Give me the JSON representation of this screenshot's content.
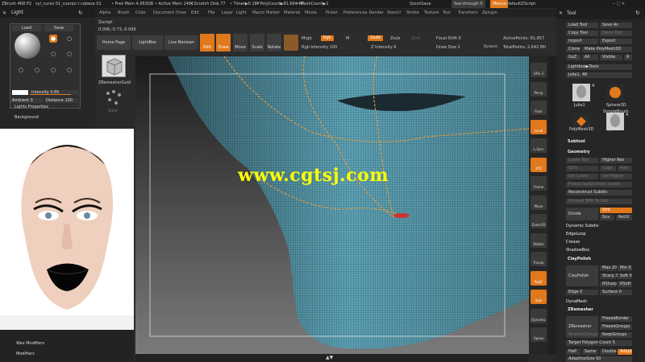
{
  "titlebar": {
    "app": "ZBrush 4R8 P2",
    "file": "syl_curso 01_cuerpo t cabeza 01",
    "free_mem": "• Free Mem 4.063GB",
    "active_mem": "• Active Mem 1461",
    "scratch": "• Scratch Disk 77",
    "timer": "• Timer▶0.187",
    "polycount": "• PolyCount▶81.664 KP",
    "meshcount": "• MeshCount▶1",
    "quicksave": "QuickSave",
    "see_through": "See-through 0",
    "menus": "Menus",
    "script": "DefaultZScript"
  },
  "menubar": [
    "Alpha",
    "Brush",
    "Color",
    "Document",
    "Draw",
    "Edit",
    "File",
    "Layer",
    "Light",
    "Macro",
    "Marker",
    "Material",
    "Movie",
    "Picker",
    "Preferences",
    "Render",
    "Stencil",
    "Stroke",
    "Texture",
    "Tool",
    "Transform",
    "Zplugin"
  ],
  "left_panel": {
    "title": "Light",
    "load": "Load",
    "save": "Save",
    "intensity": "Intensity 0.85",
    "intensity_value": 0.85,
    "ambient": "Ambient 3",
    "distance": "Distance 100",
    "lights_properties": "Lights Properties",
    "background": "Background"
  },
  "left_lower": {
    "wax": "Wax Modifiers",
    "modifiers": "Modifiers"
  },
  "subpanel": {
    "zscript": "Zscript",
    "coords": "0.006,-0.73,-0.099",
    "zremesher_guide": "ZRemesherGuid",
    "slice": "Slice"
  },
  "top_shelf": {
    "home_page": "Home Page",
    "lightbox": "LightBox",
    "live_boolean": "Live Boolean",
    "edit": "Edit",
    "draw": "Draw",
    "move": "Move",
    "scale": "Scale",
    "rotate": "Rotate",
    "mrgb": "Mrgb",
    "rgb": "Rgb",
    "m": "M",
    "zadd": "Zadd",
    "zsub": "Zsub",
    "zcut": "Zcut",
    "rgb_intensity": "Rgb Intensity 100",
    "z_intensity": "Z Intensity 6",
    "focal_shift": "Focal Shift 0",
    "draw_size": "Draw Size 2",
    "dynamic": "Dynamic",
    "active_points": "ActivePoints: 81,857",
    "total_points": "TotalPoints: 2.642 Mil"
  },
  "viewport": {
    "watermark": "www.cgtsj.com"
  },
  "right_shelf": [
    "SPix 3",
    "Persp",
    "Floor",
    "Local",
    "L.Sym",
    "XYZ",
    "Frame",
    "Move",
    "Zoom3D",
    "Rotate",
    "Transp",
    "PolyF",
    "Solo",
    "Dynamic",
    "Xpose"
  ],
  "right_panel": {
    "title": "Tool",
    "load_tool": "Load Tool",
    "save_as": "Save As",
    "copy_tool": "Copy Tool",
    "paste_tool": "Paste Tool",
    "import": "Import",
    "export": "Export",
    "clone": "Clone",
    "make_polymesh": "Make PolyMesh3D",
    "goz": "GoZ",
    "all": "All",
    "visible": "Visible",
    "r": "R",
    "lightbox_tools": "Lightbox▶Tools",
    "current_tool": "Julie1. 48",
    "thumbs": [
      "Julie1",
      "Sphere3D",
      "SimpleBrush",
      "PolyMesh3D",
      "Julie1"
    ],
    "thumb_count_a": "4",
    "thumb_count_b": "4",
    "subtool": "Subtool",
    "geometry": "Geometry",
    "lower_res": "Lower Res",
    "higher_res": "Higher Res",
    "sdiv": "SDiv",
    "cage": "Cage",
    "rstr": "Rstr",
    "del_lower": "Del Lower",
    "del_higher": "Del Higher",
    "freeze_subdiv": "Freeze SubDivision Levels",
    "reconstruct_subdiv": "Reconstruct Subdiv",
    "convert_bpr": "Convert BPR To Geo",
    "divide": "Divide",
    "smt": "Smt",
    "suv": "Suv",
    "rsuv": "ReUV",
    "dynamic_subdiv": "Dynamic Subdiv",
    "edgeloop": "EdgeLoop",
    "crease": "Crease",
    "shadowbox": "ShadowBox",
    "claypolish_header": "ClayPolish",
    "claypolish": "ClayPolish",
    "max": "Max 20",
    "min": "Min 0",
    "sharp": "Sharp 30",
    "soft": "Soft 0",
    "rsharp": "RSharp",
    "rsoft": "RSoft",
    "edge": "Edge 0",
    "surface": "Surface 0",
    "dynamesh": "DynaMesh",
    "zremesher_header": "ZRemesher",
    "zremesher": "ZRemesher",
    "freeze_border": "FreezeBorder",
    "freeze_groups": "FreezeGroups",
    "keep_groups": "KeepGroups",
    "smooth_groups": "SmoothGroups",
    "target_count": "Target Polygon Count 5",
    "half": "Half",
    "same": "Same",
    "double": "Double",
    "adapt": "Adapt",
    "adaptive_size": "AdaptiveSize 50"
  }
}
